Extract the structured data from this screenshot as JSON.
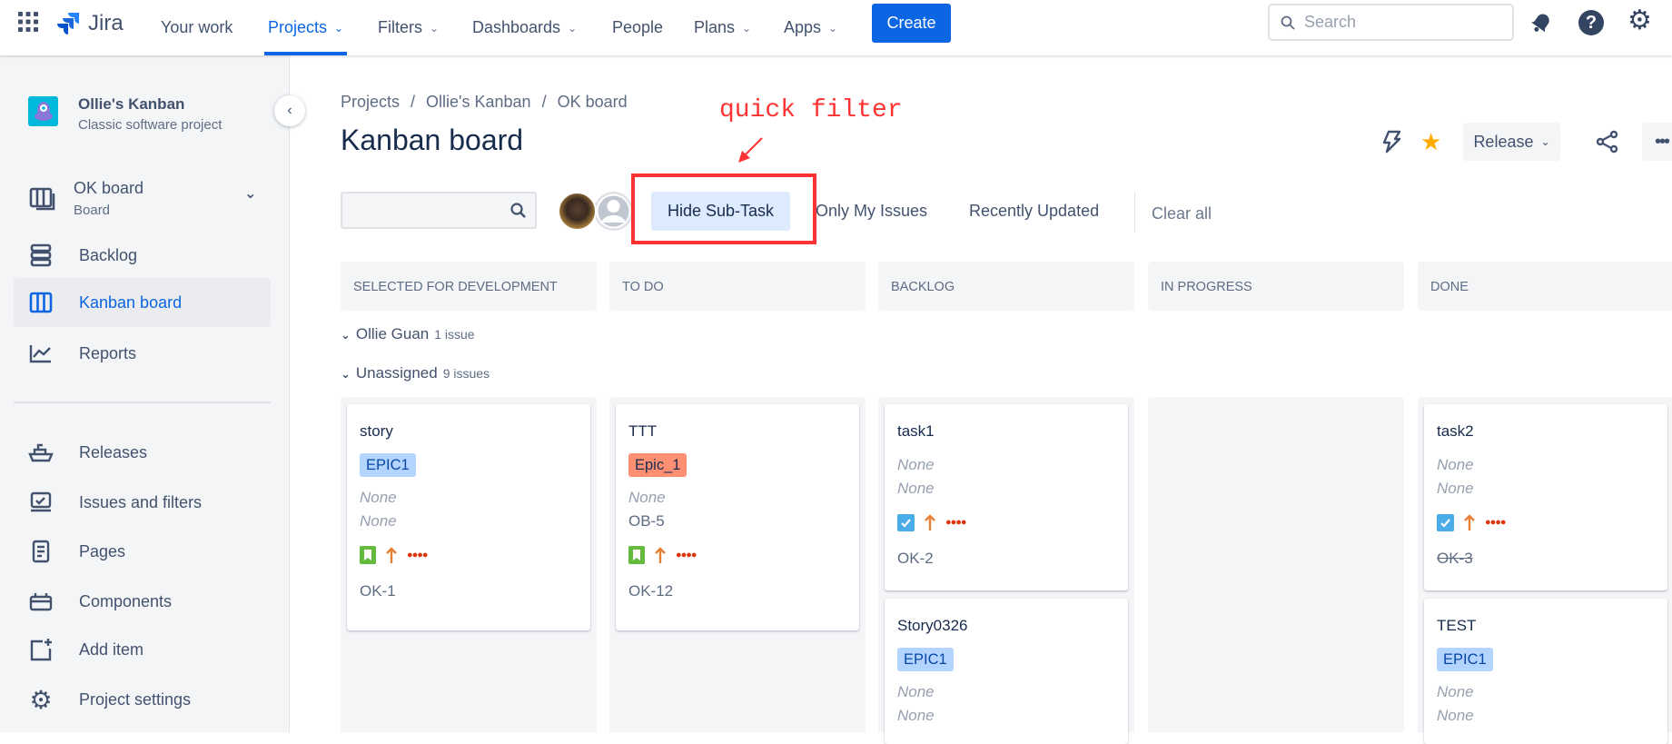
{
  "topbar": {
    "product": "Jira",
    "nav": [
      {
        "label": "Your work"
      },
      {
        "label": "Projects",
        "active": true,
        "dropdown": true
      },
      {
        "label": "Filters",
        "dropdown": true
      },
      {
        "label": "Dashboards",
        "dropdown": true
      },
      {
        "label": "People"
      },
      {
        "label": "Plans",
        "dropdown": true
      },
      {
        "label": "Apps",
        "dropdown": true
      }
    ],
    "create_label": "Create",
    "search_placeholder": "Search"
  },
  "sidebar": {
    "project_name": "Ollie's Kanban",
    "project_type": "Classic software project",
    "board_name": "OK board",
    "board_sub": "Board",
    "items": [
      {
        "label": "Backlog"
      },
      {
        "label": "Kanban board",
        "selected": true
      },
      {
        "label": "Reports"
      }
    ],
    "items2": [
      {
        "label": "Releases"
      },
      {
        "label": "Issues and filters"
      },
      {
        "label": "Pages"
      },
      {
        "label": "Components"
      },
      {
        "label": "Add item"
      },
      {
        "label": "Project settings"
      }
    ]
  },
  "breadcrumb": [
    "Projects",
    "Ollie's Kanban",
    "OK board"
  ],
  "page_title": "Kanban board",
  "annotation": {
    "text": "quick filter",
    "color": "#ff3333"
  },
  "header_actions": {
    "release_label": "Release"
  },
  "filters": {
    "search_value": "",
    "quick_filters": [
      "Hide Sub-Task",
      "Only My Issues",
      "Recently Updated"
    ],
    "clear_all": "Clear all"
  },
  "columns": [
    "SELECTED FOR DEVELOPMENT",
    "TO DO",
    "BACKLOG",
    "IN PROGRESS",
    "DONE"
  ],
  "swimlanes": [
    {
      "name": "Ollie Guan",
      "count": "1 issue"
    },
    {
      "name": "Unassigned",
      "count": "9 issues"
    }
  ],
  "cards": {
    "c1": {
      "title": "story",
      "epic": "EPIC1",
      "line1": "None",
      "line2": "None",
      "key": "OK-1"
    },
    "c2": {
      "title": "TTT",
      "epic": "Epic_1",
      "line1": "None",
      "line2": "OB-5",
      "key": "OK-12"
    },
    "c3": {
      "title": "task1",
      "line1": "None",
      "line2": "None",
      "key": "OK-2"
    },
    "c4": {
      "title": "Story0326",
      "epic": "EPIC1",
      "line1": "None",
      "line2": "None"
    },
    "c5": {
      "title": "task2",
      "line1": "None",
      "line2": "None",
      "key": "OK-3"
    },
    "c6": {
      "title": "TEST",
      "epic": "EPIC1",
      "line1": "None",
      "line2": "None"
    }
  },
  "colors": {
    "brand": "#0c66e4",
    "epic_blue": "#b3d4ff",
    "epic_red": "#ff8f73",
    "story_green": "#63ba3c",
    "task_blue": "#4bade8",
    "priority_orange": "#e97f33"
  }
}
